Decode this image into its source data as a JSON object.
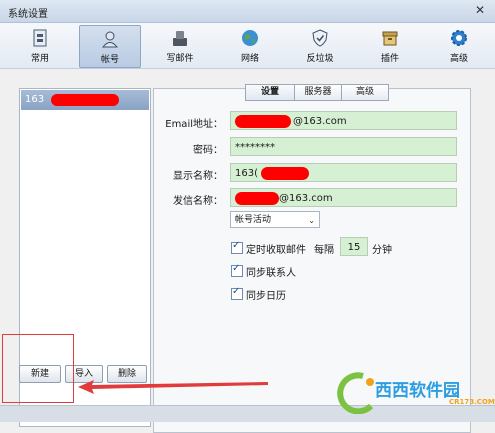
{
  "window": {
    "title": "系统设置",
    "close_glyph": "✕"
  },
  "toolbar": {
    "items": [
      {
        "label": "常用",
        "icon": "general-icon"
      },
      {
        "label": "帐号",
        "icon": "account-icon",
        "active": true
      },
      {
        "label": "写邮件",
        "icon": "compose-icon"
      },
      {
        "label": "网络",
        "icon": "globe-icon"
      },
      {
        "label": "反垃圾",
        "icon": "shield-icon"
      },
      {
        "label": "插件",
        "icon": "plugin-icon"
      },
      {
        "label": "高级",
        "icon": "gear-icon"
      }
    ]
  },
  "accounts": {
    "items": [
      {
        "label": "163"
      }
    ]
  },
  "tabs": [
    {
      "label": "设置",
      "selected": true
    },
    {
      "label": "服务器"
    },
    {
      "label": "高级"
    }
  ],
  "form": {
    "email_label": "Email地址：",
    "email_value": "@163.com",
    "password_label": "密码：",
    "password_value": "********",
    "display_name_label": "显示名称：",
    "display_name_value": "163(",
    "sender_name_label": "发信名称：",
    "sender_name_value": "@163.com",
    "status_select": "帐号活动"
  },
  "options": {
    "timed_fetch_label": "定时收取邮件",
    "interval_prefix": "每隔",
    "interval_value": "15",
    "interval_unit": "分钟",
    "sync_contacts_label": "同步联系人",
    "sync_calendar_label": "同步日历"
  },
  "buttons": {
    "new": "新建",
    "import": "导入",
    "delete": "删除"
  },
  "watermark": {
    "site": "西西软件园",
    "domain": "CR173.COM"
  },
  "colors": {
    "field_bg": "#d5f0d3",
    "redaction": "#ff0000",
    "accent": "#8aa3c4",
    "annotation": "#e23b3b"
  }
}
